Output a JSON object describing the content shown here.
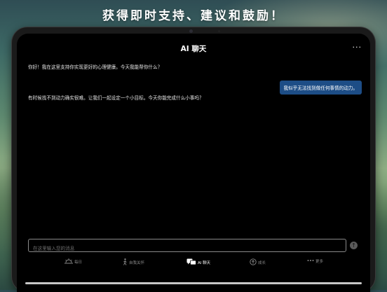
{
  "headline": "获得即时支持、建议和鼓励！",
  "chat": {
    "title": "AI 聊天",
    "more_label": "···",
    "messages": [
      {
        "role": "ai",
        "text": "你好！我在这里支持你实现更好的心理健康。今天我能帮你什么？"
      },
      {
        "role": "user",
        "text": "我似乎无法找到做任何事情的动力。"
      },
      {
        "role": "ai",
        "text": "有时候找不到动力确实很难。让我们一起设定一个小目标。今天你能完成什么小事吗？"
      }
    ]
  },
  "input": {
    "placeholder": "在这里输入您的消息",
    "value": ""
  },
  "send_icon": "send-icon",
  "tabs": [
    {
      "label": "每日",
      "icon": "sunrise-icon",
      "active": false
    },
    {
      "label": "自我关怀",
      "icon": "walking-person-icon",
      "active": false
    },
    {
      "label": "AI 聊天",
      "icon": "chat-bubbles-icon",
      "active": true
    },
    {
      "label": "成长",
      "icon": "growth-icon",
      "active": false
    },
    {
      "label": "更多",
      "icon": "more-dots-icon",
      "active": false
    }
  ],
  "colors": {
    "user_bubble": "#1d4d86",
    "screen_bg": "#000000",
    "active_tab": "#ffffff",
    "inactive_tab": "#8a8a8a"
  }
}
